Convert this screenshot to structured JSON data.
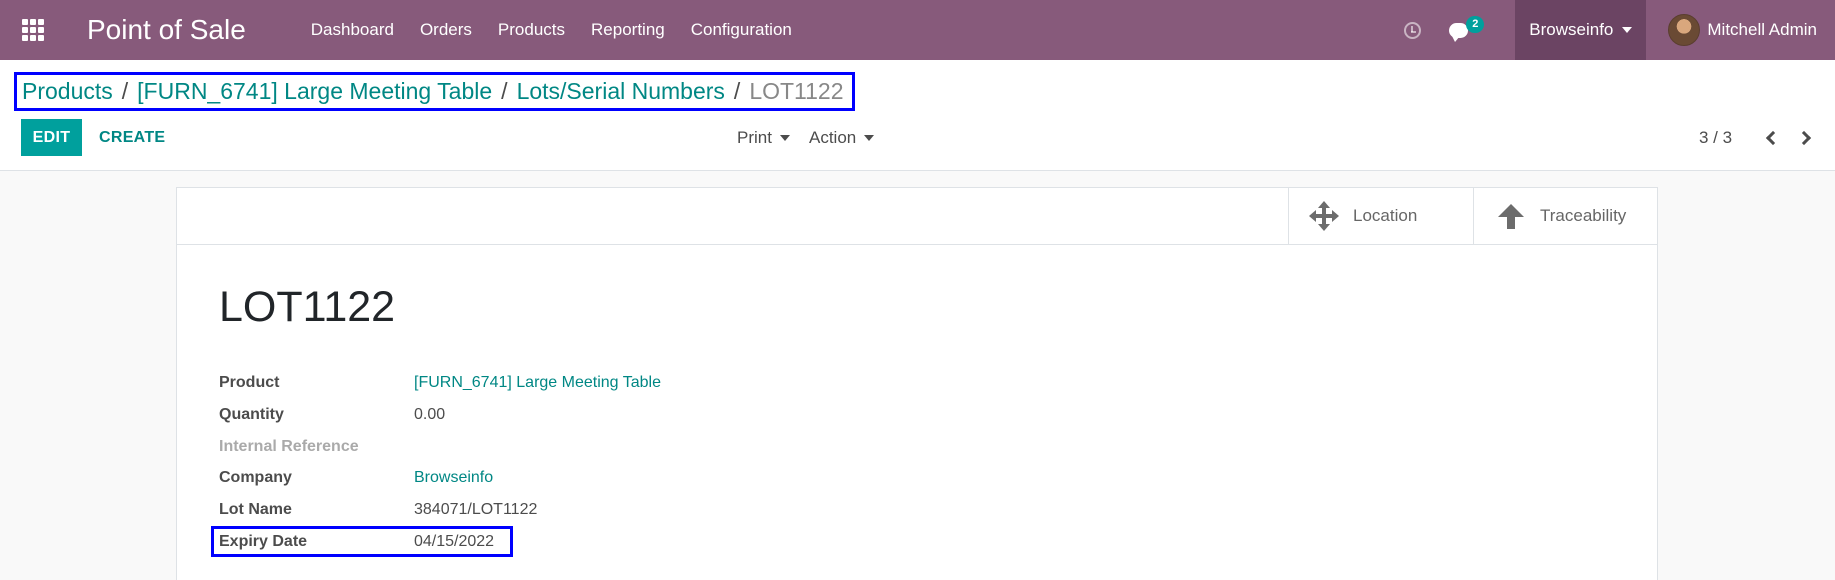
{
  "navbar": {
    "app_title": "Point of Sale",
    "menu": [
      "Dashboard",
      "Orders",
      "Products",
      "Reporting",
      "Configuration"
    ],
    "messages_badge": "2",
    "company": "Browseinfo",
    "user": "Mitchell Admin",
    "bg_color": "#875a7b"
  },
  "breadcrumb": {
    "items": [
      "Products",
      "[FURN_6741] Large Meeting Table",
      "Lots/Serial Numbers"
    ],
    "active": "LOT1122",
    "separator": "/"
  },
  "toolbar": {
    "edit_label": "EDIT",
    "create_label": "CREATE",
    "print_label": "Print",
    "action_label": "Action",
    "pager": "3 / 3"
  },
  "smart_buttons": {
    "location": "Location",
    "traceability": "Traceability"
  },
  "record": {
    "title": "LOT1122",
    "fields": [
      {
        "label": "Product",
        "value": "[FURN_6741] Large Meeting Table"
      },
      {
        "label": "Quantity",
        "value": "0.00"
      },
      {
        "label": "Internal Reference",
        "value": ""
      },
      {
        "label": "Company",
        "value": "Browseinfo"
      },
      {
        "label": "Lot Name",
        "value": "384071/LOT1122"
      },
      {
        "label": "Expiry Date",
        "value": "04/15/2022"
      }
    ]
  },
  "colors": {
    "accent": "#00a09d",
    "link": "#008784",
    "highlight": "#0000ff"
  }
}
